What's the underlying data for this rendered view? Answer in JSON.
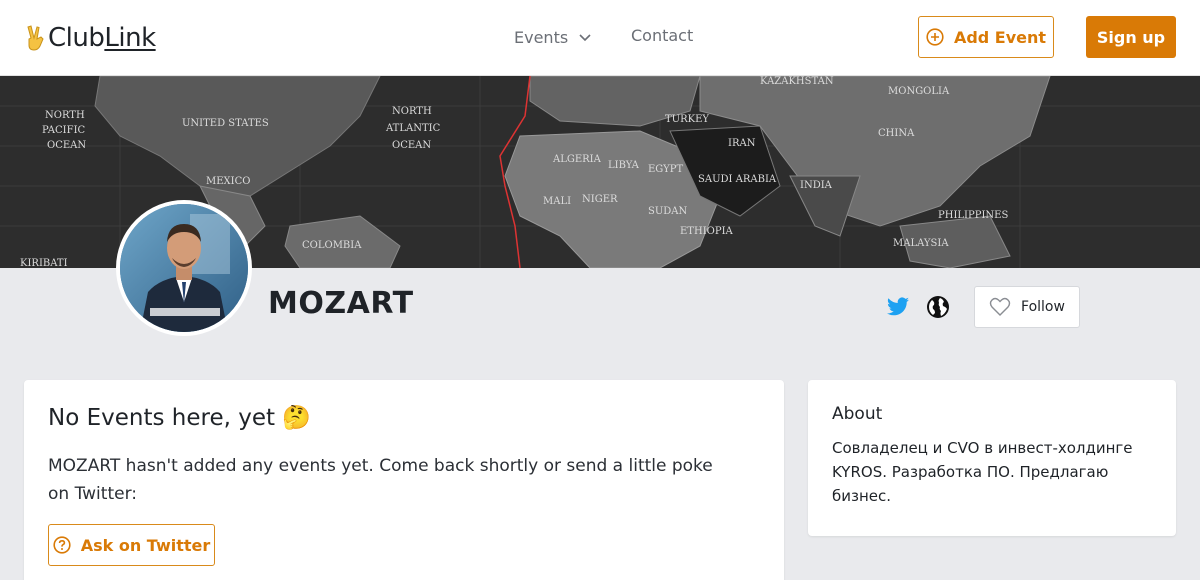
{
  "header": {
    "logo_emoji": "✌",
    "logo_text_a": "Club",
    "logo_text_b": "Link",
    "nav": {
      "events_label": "Events",
      "contact_label": "Contact"
    },
    "add_event_label": "Add Event",
    "signup_label": "Sign up"
  },
  "cover": {
    "map_labels": [
      "UNITED STATES",
      "NORTH",
      "PACIFIC",
      "OCEAN",
      "NORTH",
      "ATLANTIC",
      "OCEAN",
      "MEXICO",
      "ALGERIA",
      "LIBYA",
      "EGYPT",
      "SAUDI ARABIA",
      "IRAN",
      "INDIA",
      "CHINA",
      "MONGOLIA",
      "KAZAKHSTAN",
      "TURKEY",
      "SUDAN",
      "MALI",
      "NIGER",
      "ETHIOPIA",
      "PHILIPPINES",
      "MALAYSIA",
      "COLOMBIA",
      "KIRIBATI"
    ]
  },
  "profile": {
    "name": "MOZART",
    "follow_label": "Follow"
  },
  "events": {
    "title": "No Events here, yet 🤔",
    "text": "MOZART hasn't added any events yet. Come back shortly or send a little poke on Twitter:",
    "ask_label": "Ask on Twitter"
  },
  "about": {
    "title": "About",
    "text": "Совладелец и CVO в инвест-холдинге KYROS. Разработка ПО. Предлагаю бизнес."
  },
  "colors": {
    "accent": "#d97a06",
    "twitter": "#1da1f2",
    "page_bg": "#e9eaed"
  }
}
